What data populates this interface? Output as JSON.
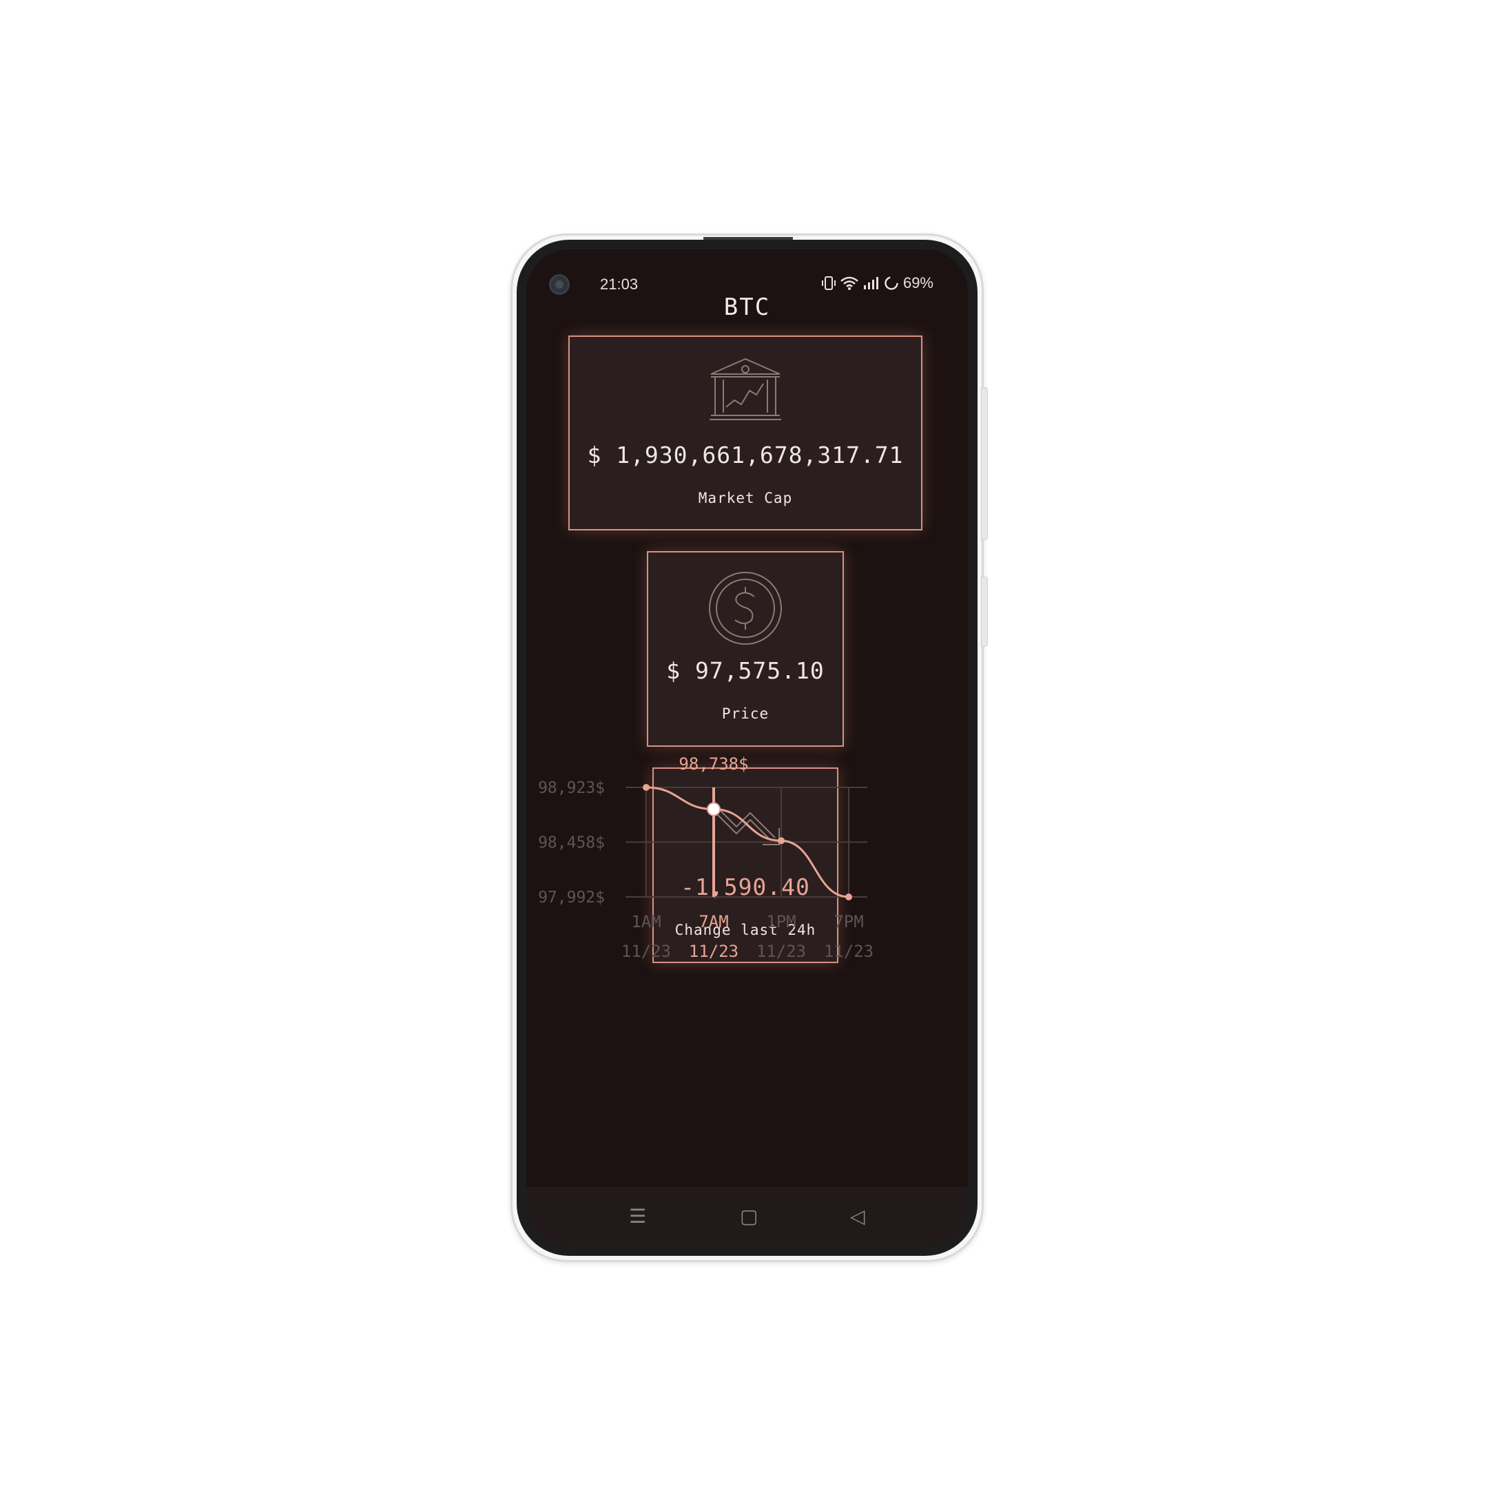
{
  "status_bar": {
    "time": "21:03",
    "battery": "69%"
  },
  "header": {
    "title": "BTC"
  },
  "cards": {
    "market_cap": {
      "value": "$ 1,930,661,678,317.71",
      "label": "Market Cap",
      "icon": "bank-chart-icon"
    },
    "price": {
      "value": "$ 97,575.10",
      "label": "Price",
      "icon": "dollar-coin-icon"
    },
    "change": {
      "value": "-1,590.40",
      "label": "Change last 24h",
      "icon": "trend-down-icon"
    }
  },
  "chart_data": {
    "type": "line",
    "x_labels": [
      {
        "time": "1AM",
        "date": "11/23"
      },
      {
        "time": "7AM",
        "date": "11/23"
      },
      {
        "time": "1PM",
        "date": "11/23"
      },
      {
        "time": "7PM",
        "date": "11/23"
      }
    ],
    "y_ticks": [
      "98,923$",
      "98,458$",
      "97,992$"
    ],
    "y_tick_values": [
      98923,
      98458,
      97992
    ],
    "ylim": [
      97992,
      98923
    ],
    "values": [
      98923,
      98738,
      98470,
      97992
    ],
    "selected_index": 1,
    "selected_label": "98,738$",
    "colors": {
      "line": "#e8a495",
      "grid": "#4a3c3a",
      "axis_text": "#5f5452",
      "selected_text": "#e8a495"
    }
  },
  "navbar": {
    "menu_icon": "☰",
    "home_icon": "▢",
    "back_icon": "◁"
  },
  "colors": {
    "accent": "#e8a495",
    "background": "#1b1211",
    "card": "#2a1f1e"
  }
}
